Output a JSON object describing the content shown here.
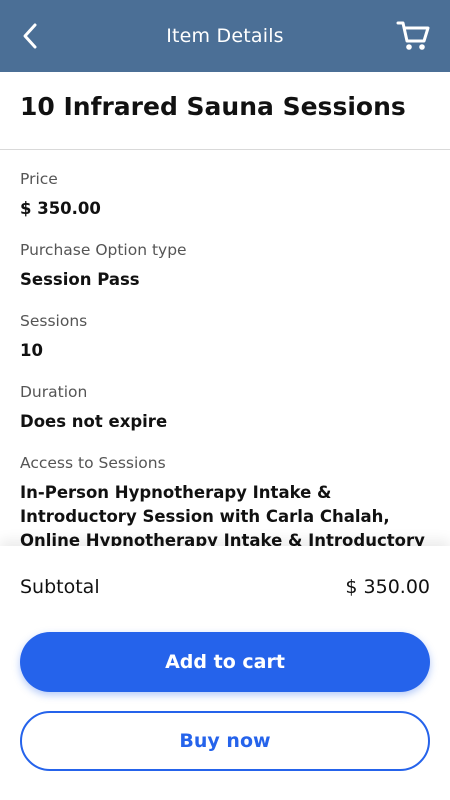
{
  "header": {
    "title": "Item Details",
    "back_icon": "chevron-left-icon",
    "cart_icon": "shopping-cart-icon",
    "background_color": "#4b6f96"
  },
  "item": {
    "title": "10 Infrared Sauna Sessions"
  },
  "fields": [
    {
      "label": "Price",
      "value": "$ 350.00"
    },
    {
      "label": "Purchase Option type",
      "value": "Session Pass"
    },
    {
      "label": "Sessions",
      "value": "10"
    },
    {
      "label": "Duration",
      "value": "Does not expire"
    },
    {
      "label": "Access to Sessions",
      "value": "In-Person Hypnotherapy Intake & Introductory Session with Carla Chalah, Online Hypnotherapy Intake & Introductory Session with Carla Chalah"
    }
  ],
  "summary": {
    "subtotal_label": "Subtotal",
    "subtotal_value": "$ 350.00"
  },
  "actions": {
    "add_to_cart_label": "Add to cart",
    "buy_now_label": "Buy now",
    "accent_color": "#2563eb"
  }
}
